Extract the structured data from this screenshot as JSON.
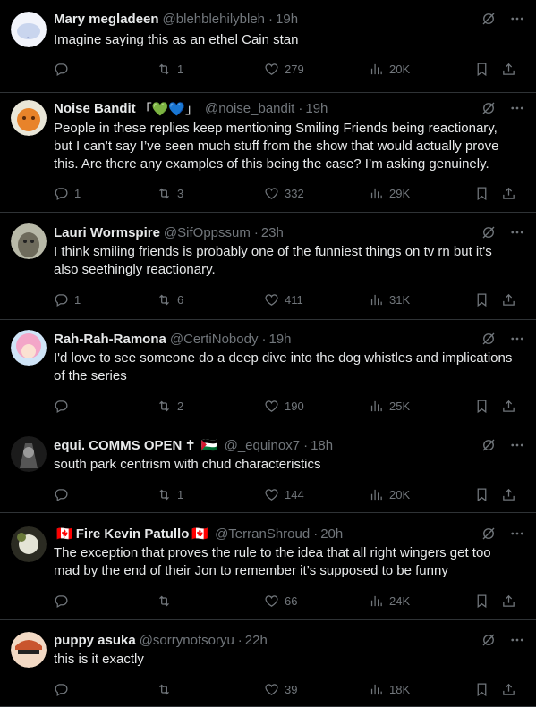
{
  "tweets": [
    {
      "name": "Mary megladeen",
      "flags_before": "",
      "flags_after": "",
      "handle": "@blehblehilybleh",
      "time": "19h",
      "text": "Imagine saying this as an ethel Cain stan",
      "replies": "",
      "retweets": "1",
      "likes": "279",
      "views": "20K",
      "avatar_color": "#d9e3f5"
    },
    {
      "name": "Noise Bandit",
      "name_suffix": "「💚💙」",
      "flags_before": "",
      "flags_after": "",
      "handle": "@noise_bandit",
      "time": "19h",
      "text": "People in these replies keep mentioning Smiling Friends being reactionary, but I can’t say I’ve seen much stuff from the show that would actually prove this. Are there any examples of this being the case? I’m asking genuinely.",
      "replies": "1",
      "retweets": "3",
      "likes": "332",
      "views": "29K",
      "avatar_color": "#e8832a"
    },
    {
      "name": "Lauri Wormspire",
      "flags_before": "",
      "flags_after": "",
      "handle": "@SifOppssum",
      "time": "23h",
      "text": "I think smiling friends is probably one of the funniest things on tv rn but it's also seethingly reactionary.",
      "replies": "1",
      "retweets": "6",
      "likes": "411",
      "views": "31K",
      "avatar_color": "#8a8f7c"
    },
    {
      "name": "Rah-Rah-Ramona",
      "flags_before": "",
      "flags_after": "",
      "handle": "@CertiNobody",
      "time": "19h",
      "text": "I'd love to see someone do a deep dive into the dog whistles and implications of the series",
      "replies": "",
      "retweets": "2",
      "likes": "190",
      "views": "25K",
      "avatar_color": "#f3a6c8"
    },
    {
      "name": "equi. COMMS OPEN",
      "name_suffix": "✝",
      "flags_before": "",
      "flags_after": "🇵🇸",
      "handle": "@_equinox7",
      "time": "18h",
      "text": "south park centrism with chud characteristics",
      "replies": "",
      "retweets": "1",
      "likes": "144",
      "views": "20K",
      "avatar_color": "#3b3b3b"
    },
    {
      "name": "Fire Kevin Patullo",
      "flags_before": "🇨🇦",
      "flags_after": "🇨🇦",
      "handle": "@TerranShroud",
      "time": "20h",
      "text": "The exception that proves the rule to the idea that all right wingers get too mad by the end of their Jon to remember it’s supposed to be funny",
      "replies": "",
      "retweets": "",
      "likes": "66",
      "views": "24K",
      "avatar_color": "#4a4a38"
    },
    {
      "name": "puppy asuka",
      "flags_before": "",
      "flags_after": "",
      "handle": "@sorrynotsoryu",
      "time": "22h",
      "text": "this is it exactly",
      "replies": "",
      "retweets": "",
      "likes": "39",
      "views": "18K",
      "avatar_color": "#c9552e"
    }
  ],
  "icons": {
    "grok": "grok-icon",
    "more": "more-icon",
    "reply": "reply-icon",
    "retweet": "retweet-icon",
    "like": "heart-icon",
    "views": "views-icon",
    "bookmark": "bookmark-icon",
    "share": "share-icon"
  },
  "colors": {
    "background": "#000000",
    "text": "#e7e9ea",
    "muted": "#71767b",
    "divider": "#2f3336"
  }
}
